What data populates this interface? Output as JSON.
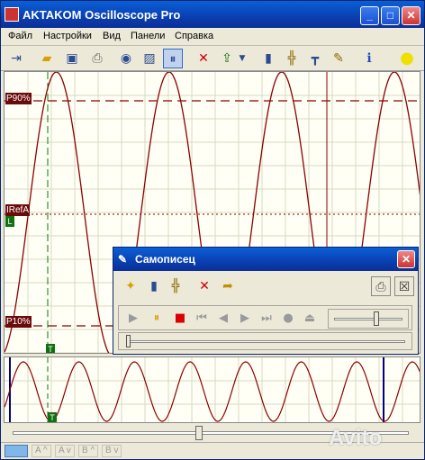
{
  "app": {
    "title": "AKTAKOM Oscilloscope Pro"
  },
  "menu": [
    "Файл",
    "Настройки",
    "Вид",
    "Панели",
    "Справка"
  ],
  "markers": {
    "p90": "P90%",
    "iref": "IRefA",
    "p10": "P10%",
    "trigger_left": "L",
    "time_cursor": "T"
  },
  "dialog": {
    "title": "Самописец"
  },
  "status": {
    "items": [
      "A ^",
      "A v",
      "B ^",
      "B v"
    ]
  },
  "watermark": "Avito",
  "colors": {
    "signal": "#8b0000",
    "cursor_green": "#0a7a0a",
    "cursor_blue": "#000080",
    "grid": "#d9d9c8"
  },
  "icons": {
    "toolbar": [
      "exit-icon",
      "open-folder-icon",
      "save-icon",
      "print-icon",
      "camera-icon",
      "screenshot-icon",
      "pause-icon",
      "delete-icon",
      "export-icon",
      "info-icon",
      "probe-icon",
      "cursor-settings-icon",
      "tools-icon",
      "help-icon",
      "status-led-icon"
    ],
    "dialog_tools": [
      "new-icon",
      "info-icon",
      "probe-icon",
      "delete-icon",
      "open-icon",
      "print-icon",
      "close-icon"
    ],
    "dialog_playback": [
      "play-icon",
      "pause-icon",
      "stop-icon",
      "skip-start-icon",
      "step-back-icon",
      "step-forward-icon",
      "skip-end-icon",
      "record-icon",
      "eject-icon"
    ]
  },
  "chart_data": [
    {
      "type": "line",
      "series": [
        {
          "name": "",
          "cycles_visible": 3.7
        }
      ],
      "markers": [
        "P90%",
        "IRefA",
        "P10%"
      ],
      "grid": true
    },
    {
      "type": "line",
      "series": [
        {
          "name": "",
          "cycles_visible": 7.5
        }
      ],
      "grid": true
    }
  ]
}
